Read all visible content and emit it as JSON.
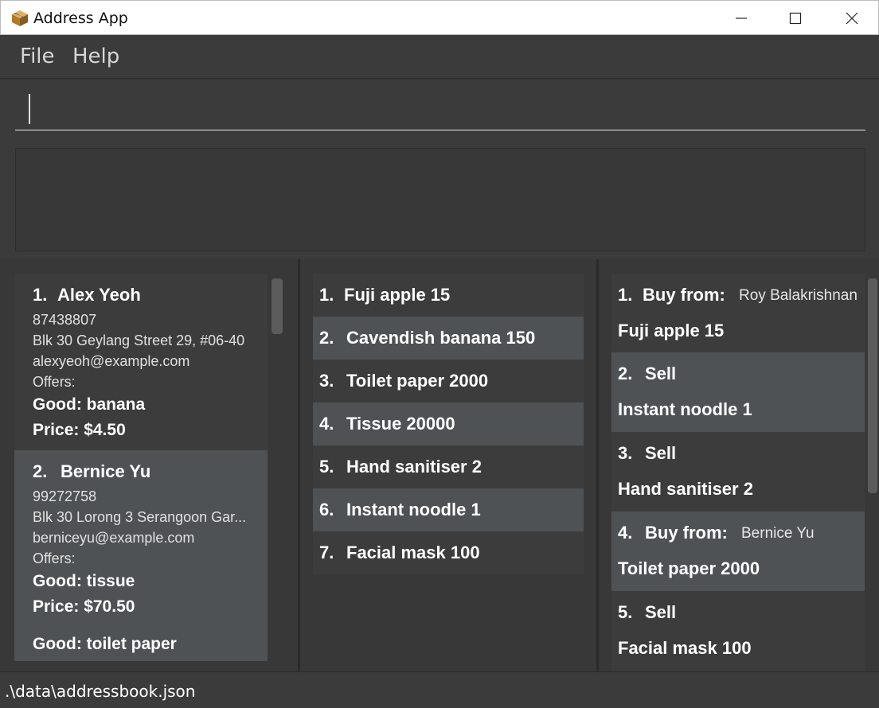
{
  "window": {
    "title": "Address App"
  },
  "menu": {
    "file": "File",
    "help": "Help"
  },
  "command": {
    "value": ""
  },
  "persons": [
    {
      "index": "1.",
      "name": "Alex Yeoh",
      "phone": "87438807",
      "address": "Blk 30 Geylang Street 29, #06-40",
      "email": "alexyeoh@example.com",
      "offers_label": "Offers:",
      "good1": "Good: banana",
      "price1": "Price: $4.50"
    },
    {
      "index": "2.",
      "name": "Bernice Yu",
      "phone": "99272758",
      "address": "Blk 30 Lorong 3 Serangoon Gar...",
      "email": "berniceyu@example.com",
      "offers_label": "Offers:",
      "good1": "Good: tissue",
      "price1": "Price: $70.50",
      "good2": "Good: toilet paper"
    }
  ],
  "inventory": [
    {
      "index": "1.",
      "label": "Fuji apple 15"
    },
    {
      "index": "2.",
      "label": "Cavendish banana 150"
    },
    {
      "index": "3.",
      "label": "Toilet paper 2000"
    },
    {
      "index": "4.",
      "label": "Tissue 20000"
    },
    {
      "index": "5.",
      "label": "Hand sanitiser 2"
    },
    {
      "index": "6.",
      "label": "Instant noodle 1"
    },
    {
      "index": "7.",
      "label": "Facial mask 100"
    }
  ],
  "orders": [
    {
      "index": "1.",
      "type": "Buy from:",
      "party": "Roy Balakrishnan",
      "item": "Fuji apple 15"
    },
    {
      "index": "2.",
      "type": "Sell",
      "party": "",
      "item": "Instant noodle 1"
    },
    {
      "index": "3.",
      "type": "Sell",
      "party": "",
      "item": "Hand sanitiser 2"
    },
    {
      "index": "4.",
      "type": "Buy from:",
      "party": "Bernice Yu",
      "item": "Toilet paper 2000"
    },
    {
      "index": "5.",
      "type": "Sell",
      "party": "",
      "item": "Facial mask 100"
    }
  ],
  "status": {
    "path": ".\\data\\addressbook.json"
  },
  "colors": {
    "background": "#383838",
    "card_dark": "#3c3c3c",
    "card_light": "#4e5254",
    "text": "#ffffff"
  },
  "icons": {
    "app": "package-icon",
    "minimize": "minimize-icon",
    "maximize": "maximize-icon",
    "close": "close-icon"
  }
}
